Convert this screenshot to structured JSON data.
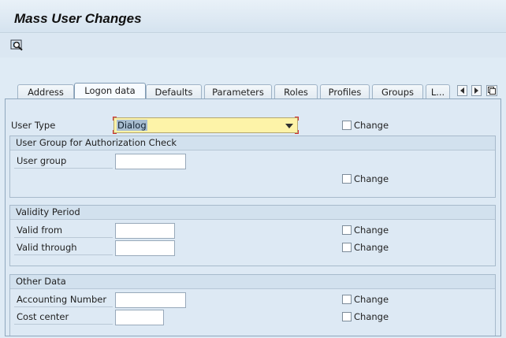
{
  "window": {
    "title": "Mass User Changes"
  },
  "toolbar": {
    "icon": "search-glasses-icon"
  },
  "tabs": [
    {
      "label": "Address",
      "active": false
    },
    {
      "label": "Logon data",
      "active": true
    },
    {
      "label": "Defaults",
      "active": false
    },
    {
      "label": "Parameters",
      "active": false
    },
    {
      "label": "Roles",
      "active": false
    },
    {
      "label": "Profiles",
      "active": false
    },
    {
      "label": "Groups",
      "active": false
    },
    {
      "label": "L...",
      "active": false
    }
  ],
  "form": {
    "user_type": {
      "label": "User Type",
      "value": "Dialog",
      "change": "Change"
    },
    "auth_group": {
      "title": "User Group for Authorization Check",
      "user_group": {
        "label": "User group",
        "value": ""
      },
      "change": "Change"
    },
    "validity": {
      "title": "Validity Period",
      "valid_from": {
        "label": "Valid from",
        "value": "",
        "change": "Change"
      },
      "valid_through": {
        "label": "Valid through",
        "value": "",
        "change": "Change"
      }
    },
    "other": {
      "title": "Other Data",
      "accounting_number": {
        "label": "Accounting Number",
        "value": "",
        "change": "Change"
      },
      "cost_center": {
        "label": "Cost center",
        "value": "",
        "change": "Change"
      }
    }
  }
}
